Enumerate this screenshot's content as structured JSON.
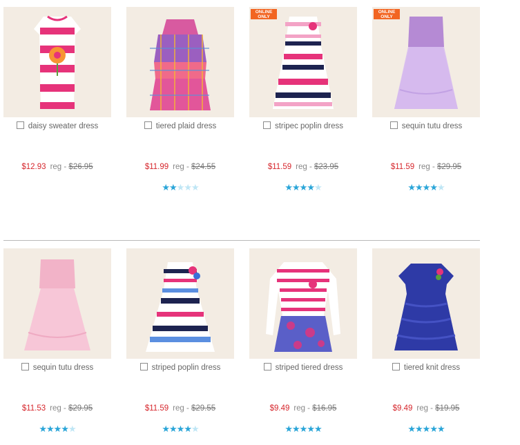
{
  "badge_text": "ONLINE ONLY",
  "reg_label": "reg -",
  "colors": {
    "sale": "#d6262c",
    "star_on": "#2aa5d8",
    "star_off": "#bfe6f5",
    "badge": "#f26522"
  },
  "products": [
    {
      "name": "daisy sweater dress",
      "sale": "$12.93",
      "reg": "$26.95",
      "rating": null,
      "online_only": false
    },
    {
      "name": "tiered plaid dress",
      "sale": "$11.99",
      "reg": "$24.55",
      "rating": 2.5,
      "online_only": false
    },
    {
      "name": "stripec poplin dress",
      "sale": "$11.59",
      "reg": "$23.95",
      "rating": 4.5,
      "online_only": true
    },
    {
      "name": "sequin tutu dress",
      "sale": "$11.59",
      "reg": "$29.95",
      "rating": 4.5,
      "online_only": true
    },
    {
      "name": "sequin tutu dress",
      "sale": "$11.53",
      "reg": "$29.95",
      "rating": 4.5,
      "online_only": false
    },
    {
      "name": "striped poplin dress",
      "sale": "$11.59",
      "reg": "$29.55",
      "rating": 4.5,
      "online_only": false
    },
    {
      "name": "striped tiered dress",
      "sale": "$9.49",
      "reg": "$16.95",
      "rating": 5,
      "online_only": false
    },
    {
      "name": "tiered knit dress",
      "sale": "$9.49",
      "reg": "$19.95",
      "rating": 5,
      "online_only": false
    }
  ]
}
